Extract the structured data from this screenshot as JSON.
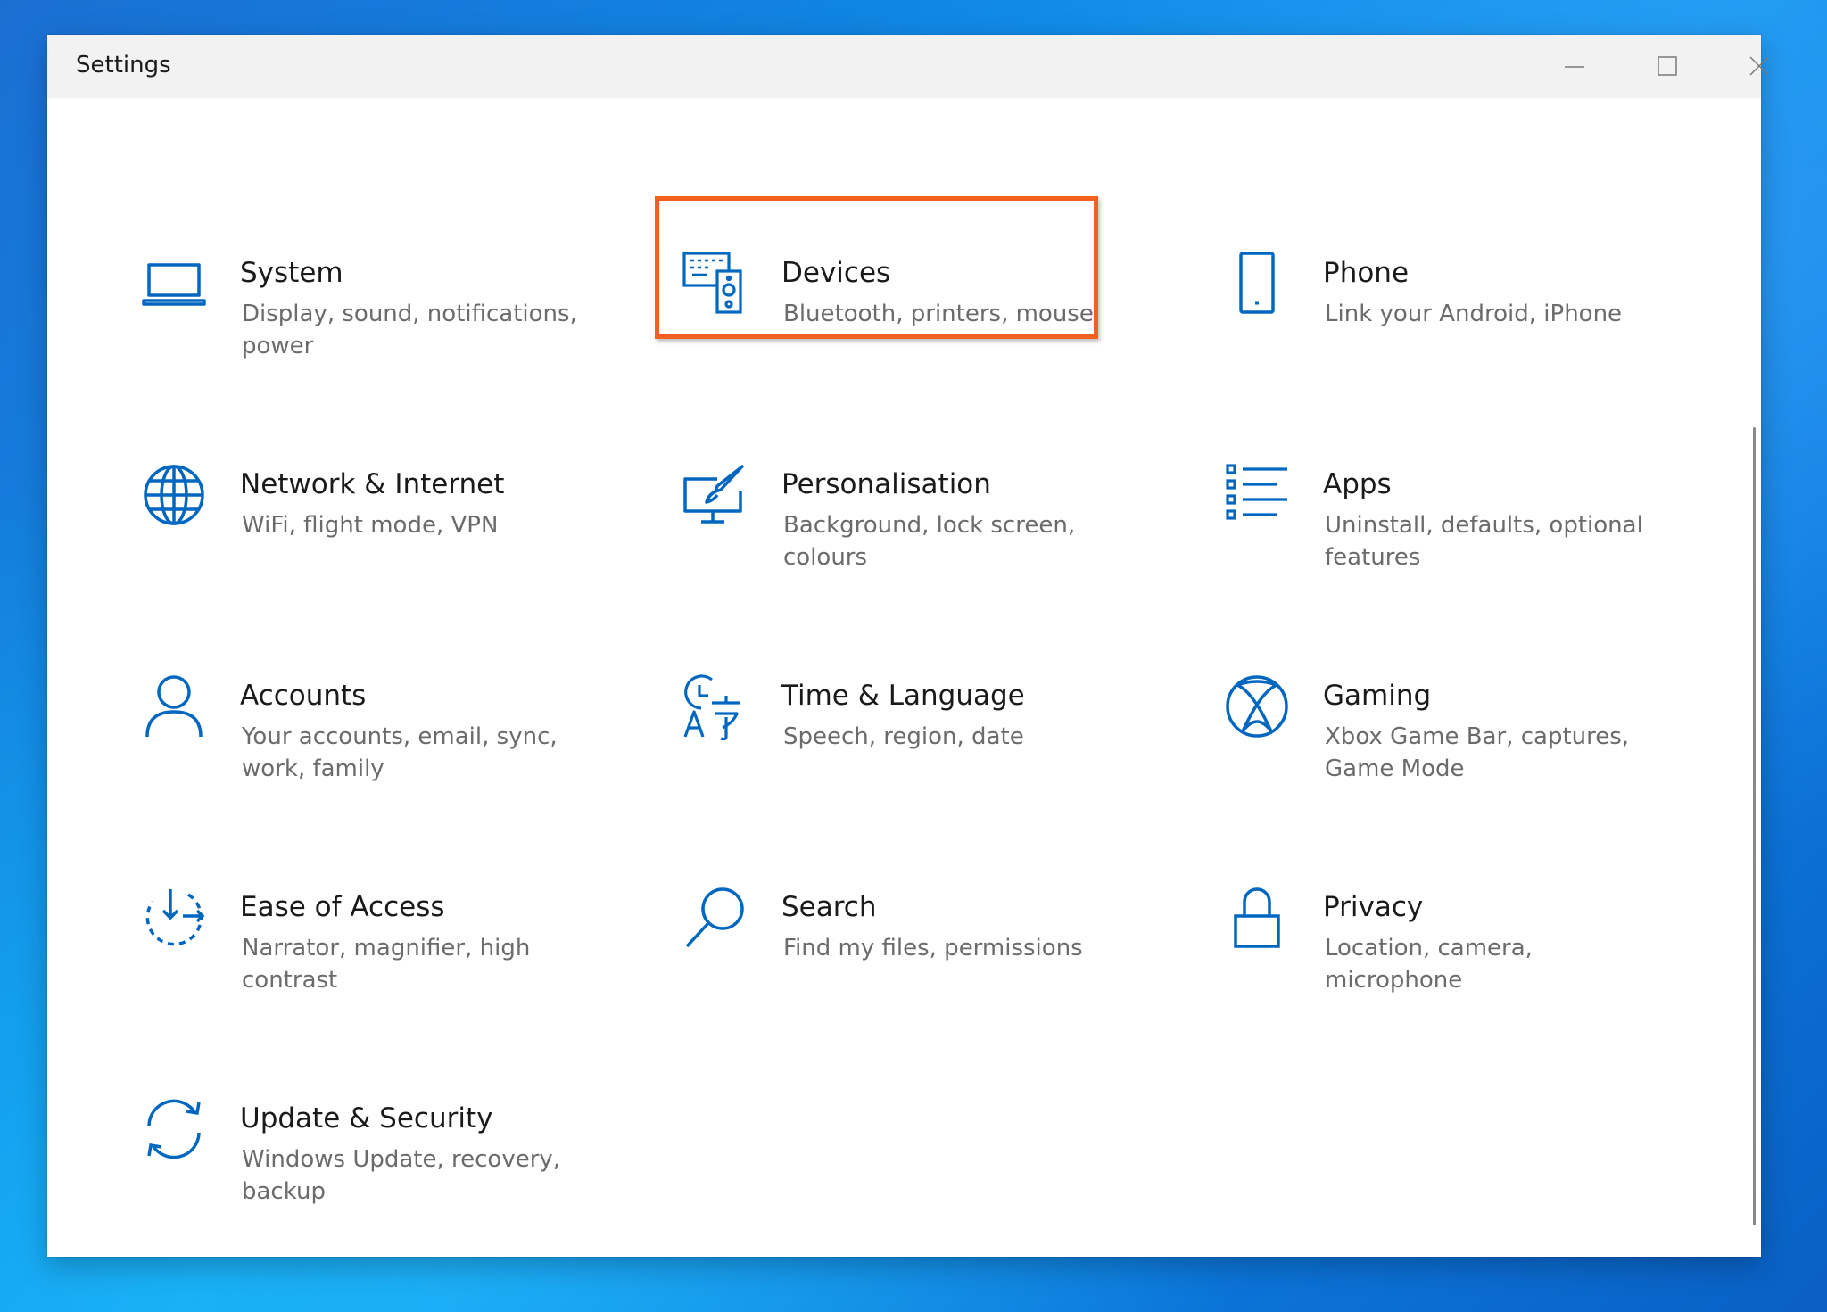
{
  "window": {
    "title": "Settings",
    "controls": [
      "minimize-icon",
      "maximize-icon",
      "close-icon"
    ]
  },
  "accent_color": "#0067c0",
  "highlight_color": "#f2611d",
  "tiles": [
    {
      "name": "System",
      "description": "Display, sound, notifications, power",
      "icon": "laptop-icon"
    },
    {
      "name": "Devices",
      "description": "Bluetooth, printers, mouse",
      "icon": "keyboard-speaker-icon",
      "highlighted": true
    },
    {
      "name": "Phone",
      "description": "Link your Android, iPhone",
      "icon": "phone-icon"
    },
    {
      "name": "Network & Internet",
      "description": "WiFi, flight mode, VPN",
      "icon": "globe-icon"
    },
    {
      "name": "Personalisation",
      "description": "Background, lock screen, colours",
      "icon": "paint-brush-icon"
    },
    {
      "name": "Apps",
      "description": "Uninstall, defaults, optional features",
      "icon": "apps-list-icon"
    },
    {
      "name": "Accounts",
      "description": "Your accounts, email, sync, work, family",
      "icon": "person-icon"
    },
    {
      "name": "Time & Language",
      "description": "Speech, region, date",
      "icon": "time-language-icon"
    },
    {
      "name": "Gaming",
      "description": "Xbox Game Bar, captures, Game Mode",
      "icon": "xbox-icon"
    },
    {
      "name": "Ease of Access",
      "description": "Narrator, magnifier, high contrast",
      "icon": "ease-of-access-icon"
    },
    {
      "name": "Search",
      "description": "Find my files, permissions",
      "icon": "search-icon"
    },
    {
      "name": "Privacy",
      "description": "Location, camera, microphone",
      "icon": "lock-icon"
    },
    {
      "name": "Update & Security",
      "description": "Windows Update, recovery, backup",
      "icon": "update-sync-icon"
    }
  ]
}
